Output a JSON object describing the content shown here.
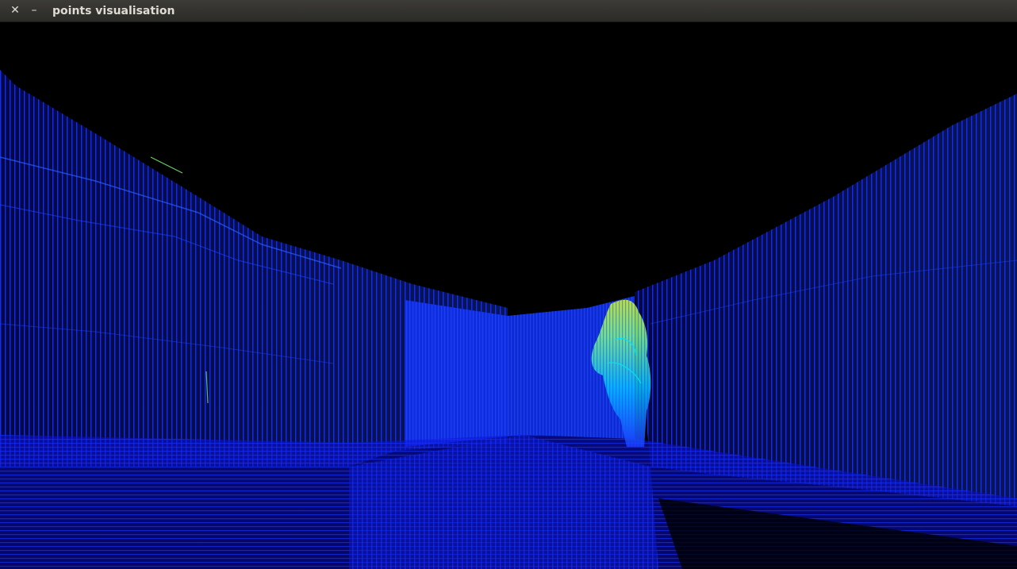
{
  "window": {
    "title": "points visualisation",
    "close_glyph": "✕",
    "minimize_glyph": "–"
  },
  "scene": {
    "type": "point-cloud",
    "background": "#000000",
    "point_colors": [
      "#0a00d8",
      "#1a3cff",
      "#00c8ff",
      "#7fff80",
      "#d8ff20"
    ]
  }
}
